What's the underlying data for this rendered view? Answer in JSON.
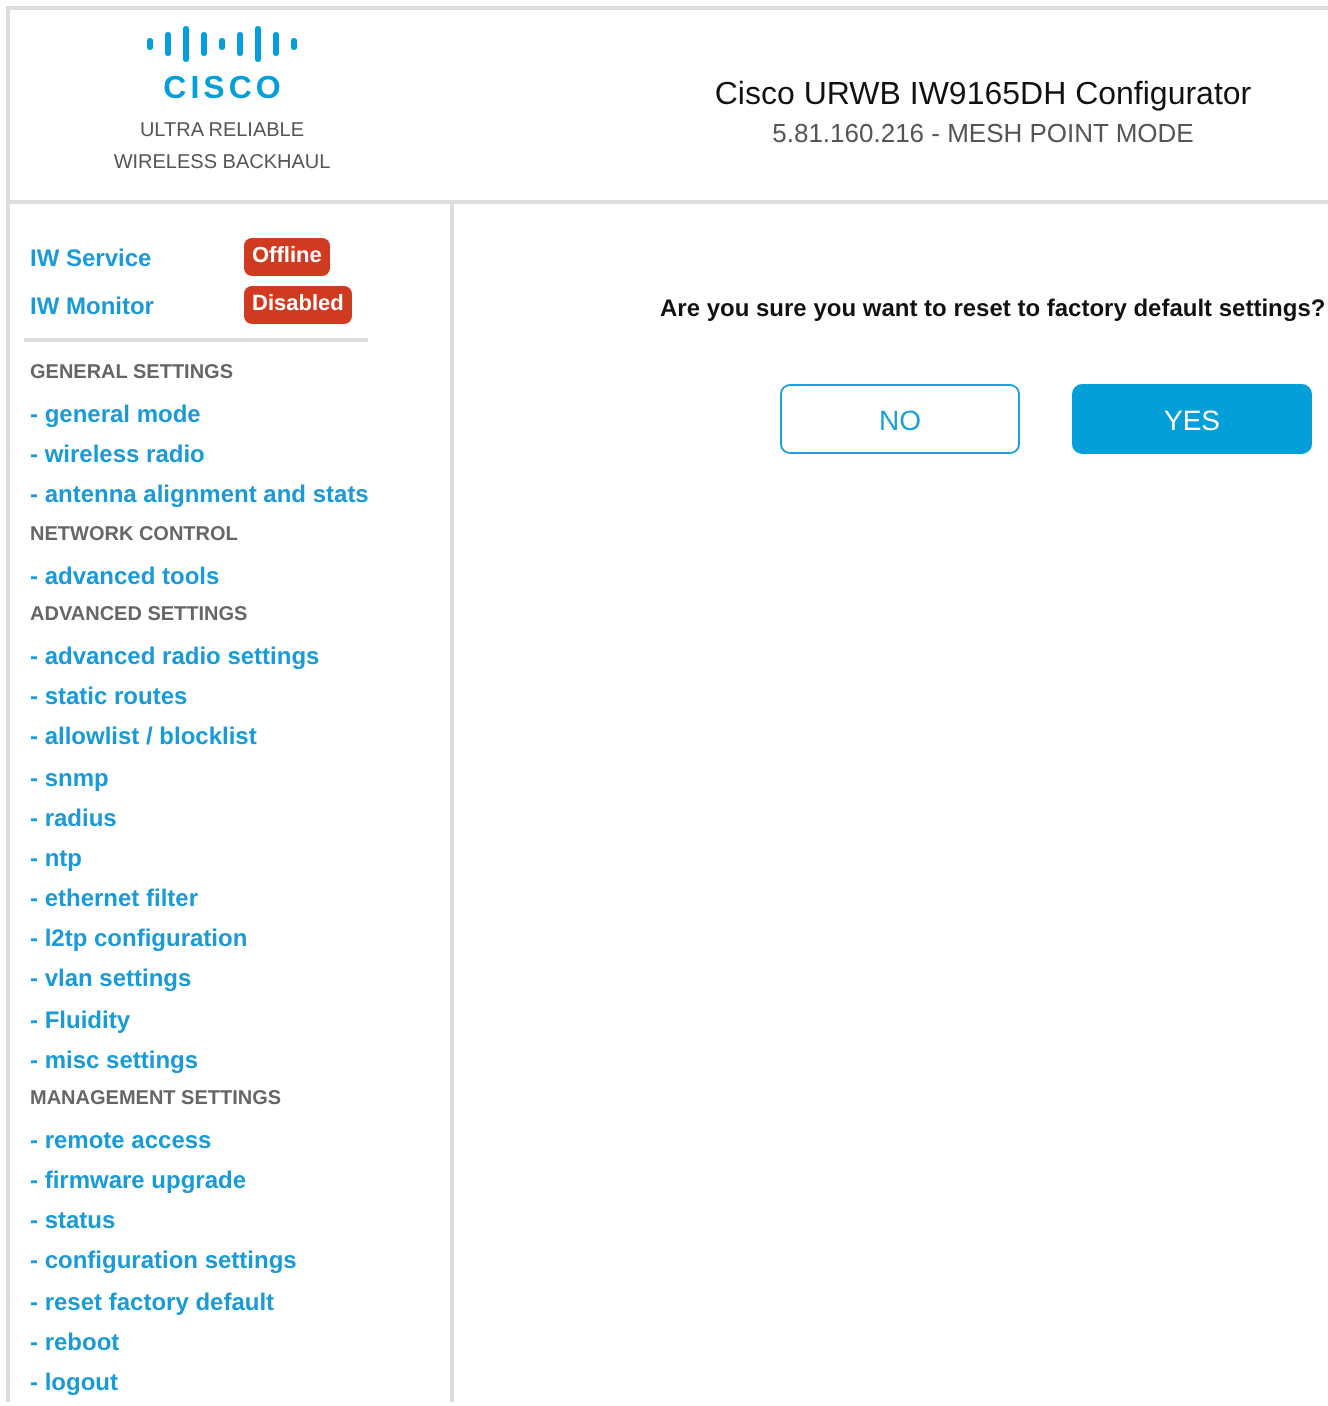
{
  "header": {
    "logo": {
      "wordmark": "CISCO",
      "tagline": [
        "ULTRA RELIABLE",
        "WIRELESS BACKHAUL"
      ]
    },
    "title": "Cisco URWB IW9165DH Configurator",
    "subtitle": "5.81.160.216 - MESH POINT MODE"
  },
  "sidebar": {
    "status": [
      {
        "label": "IW Service",
        "badge": "Offline"
      },
      {
        "label": "IW Monitor",
        "badge": "Disabled"
      }
    ],
    "items": [
      {
        "kind": "heading",
        "label": "GENERAL SETTINGS"
      },
      {
        "kind": "link",
        "label": "- general mode"
      },
      {
        "kind": "link",
        "label": "- wireless radio"
      },
      {
        "kind": "link",
        "label": "- antenna alignment and stats"
      },
      {
        "kind": "heading",
        "label": "NETWORK CONTROL"
      },
      {
        "kind": "link",
        "label": "- advanced tools"
      },
      {
        "kind": "heading",
        "label": "ADVANCED SETTINGS"
      },
      {
        "kind": "link",
        "label": "- advanced radio settings"
      },
      {
        "kind": "link",
        "label": "- static routes"
      },
      {
        "kind": "link",
        "label": "- allowlist / blocklist"
      },
      {
        "kind": "link",
        "label": "- snmp"
      },
      {
        "kind": "link",
        "label": "- radius"
      },
      {
        "kind": "link",
        "label": "- ntp"
      },
      {
        "kind": "link",
        "label": "- ethernet filter"
      },
      {
        "kind": "link",
        "label": "- l2tp configuration"
      },
      {
        "kind": "link",
        "label": "- vlan settings"
      },
      {
        "kind": "link",
        "label": "- Fluidity"
      },
      {
        "kind": "link",
        "label": "- misc settings"
      },
      {
        "kind": "heading",
        "label": "MANAGEMENT SETTINGS"
      },
      {
        "kind": "link",
        "label": "- remote access"
      },
      {
        "kind": "link",
        "label": "- firmware upgrade"
      },
      {
        "kind": "link",
        "label": "- status"
      },
      {
        "kind": "link",
        "label": "- configuration settings"
      },
      {
        "kind": "link",
        "label": "- reset factory default"
      },
      {
        "kind": "link",
        "label": "- reboot"
      },
      {
        "kind": "link",
        "label": "- logout"
      }
    ]
  },
  "dialog": {
    "question": "Are you sure you want to reset to factory default settings?",
    "buttons": [
      {
        "kind": "cancel",
        "label": "NO"
      },
      {
        "kind": "confirm",
        "label": "YES"
      }
    ]
  }
}
